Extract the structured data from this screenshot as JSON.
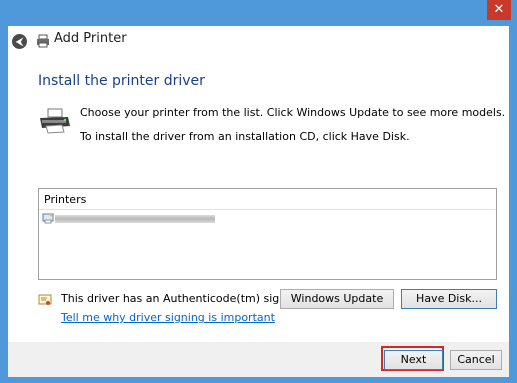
{
  "window": {
    "title": "Add Printer",
    "close_glyph": "✕",
    "back_glyph": "⮜"
  },
  "content": {
    "heading": "Install the printer driver",
    "line1": "Choose your printer from the list. Click Windows Update to see more models.",
    "line2": "To install the driver from an installation CD, click Have Disk."
  },
  "printer_list": {
    "header": "Printers",
    "items": [
      {
        "label": ""
      }
    ]
  },
  "signature": {
    "text": "This driver has an Authenticode(tm) signature.",
    "link": "Tell me why driver signing is important"
  },
  "buttons": {
    "windows_update": "Windows Update",
    "have_disk": "Have Disk...",
    "next": "Next",
    "cancel": "Cancel"
  },
  "icons": {
    "back": "back-arrow-icon",
    "printer": "printer-icon",
    "certificate": "certificate-icon",
    "close": "close-icon"
  },
  "colors": {
    "heading": "#1a3e8b",
    "link": "#0066cc",
    "highlight": "#d3282b",
    "titlebar": "#4f98d9",
    "close": "#c7392b"
  }
}
